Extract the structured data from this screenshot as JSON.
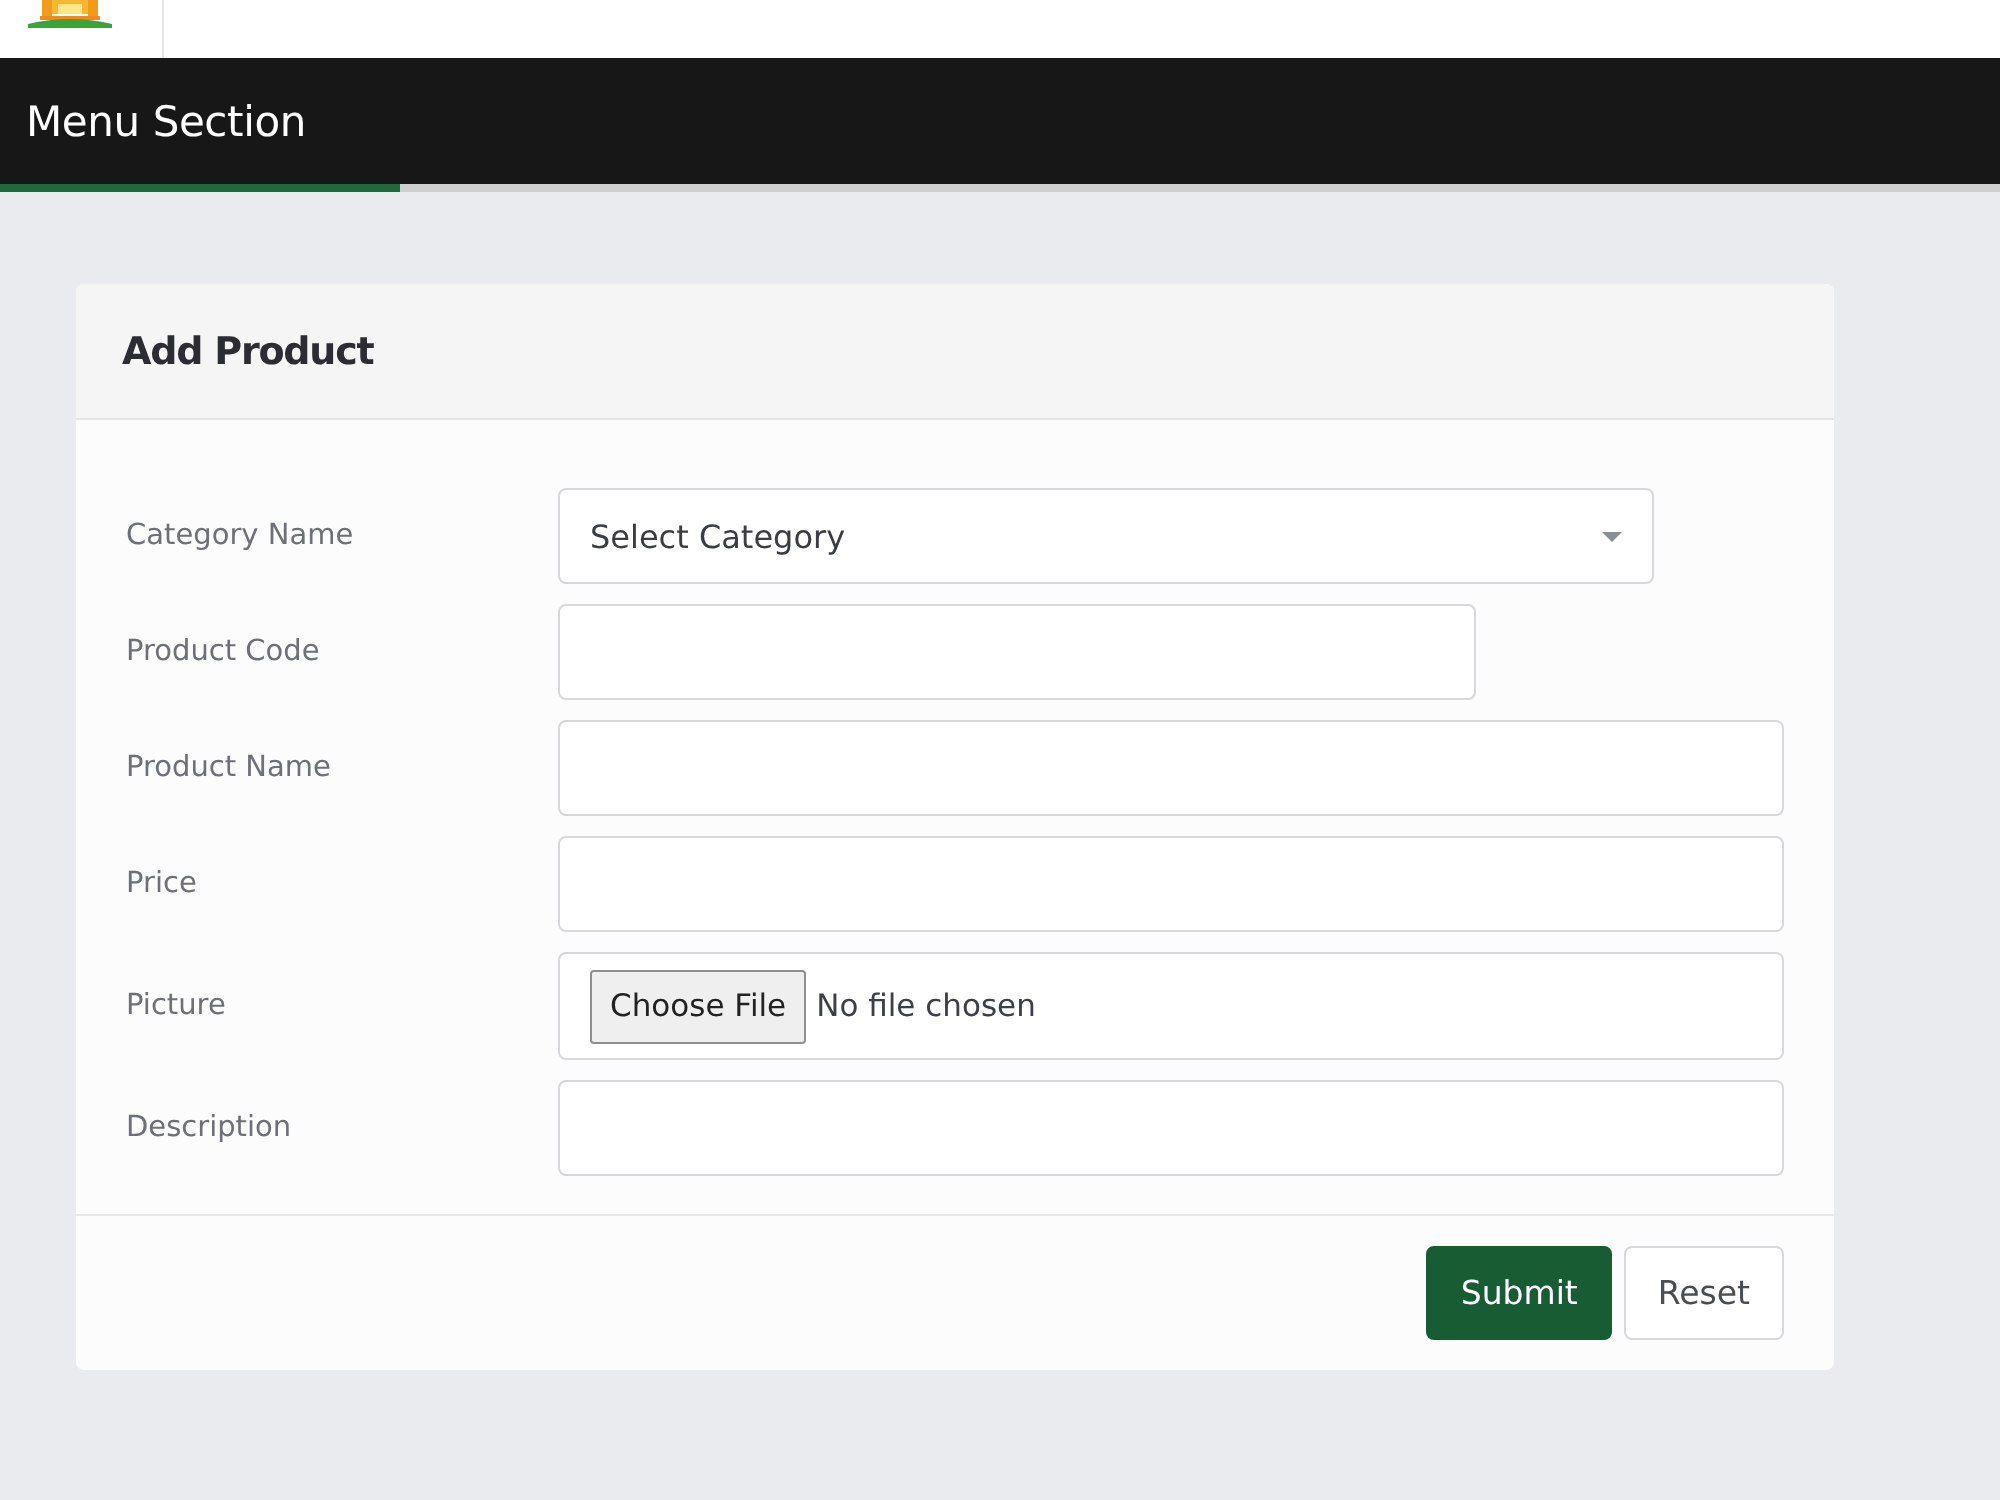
{
  "header": {
    "title": "Menu Section"
  },
  "progress": {
    "level": 0.2
  },
  "card": {
    "title": "Add Product",
    "fields": [
      {
        "label": "Category Name",
        "kind": "select",
        "value": "Select Category"
      },
      {
        "label": "Product Code",
        "kind": "short"
      },
      {
        "label": "Product Name",
        "kind": "text"
      },
      {
        "label": "Price",
        "kind": "text"
      },
      {
        "label": "Picture",
        "kind": "file",
        "button": "Choose File",
        "status": "No file chosen"
      },
      {
        "label": "Description",
        "kind": "text"
      }
    ],
    "buttons": [
      {
        "label": "Submit",
        "kind": "primary"
      },
      {
        "label": "Reset",
        "kind": "secondary"
      }
    ]
  }
}
